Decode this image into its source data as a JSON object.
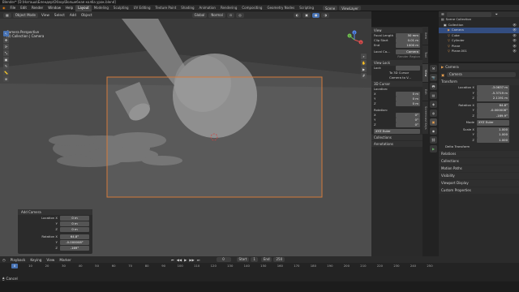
{
  "window": {
    "title": "Blender* [D:\\Наташа\\Блендер\\Обзор\\Волшебная колба урок.blend]"
  },
  "menu": {
    "items": [
      "File",
      "Edit",
      "Render",
      "Window",
      "Help"
    ],
    "workspaces": [
      "Layout",
      "Modeling",
      "Sculpting",
      "UV Editing",
      "Texture Paint",
      "Shading",
      "Animation",
      "Rendering",
      "Compositing",
      "Geometry Nodes",
      "Scripting"
    ],
    "active_workspace": "Layout",
    "scene_label": "Scene",
    "viewlayer_label": "ViewLayer"
  },
  "viewport_header": {
    "mode": "Object Mode",
    "view": "View",
    "select": "Select",
    "add": "Add",
    "object": "Object",
    "orientation": "Global",
    "pivot": "Normal"
  },
  "viewport": {
    "title_line1": "Camera Perspective",
    "title_line2": "(0) Collection | Camera",
    "gizmo_x": "X",
    "gizmo_y": "Y",
    "gizmo_z": "Z"
  },
  "toolbar": {
    "tools": [
      "↖",
      "✥",
      "⟳",
      "⤡",
      "▣",
      "✎",
      "📏",
      "⊞"
    ]
  },
  "npanel": {
    "view_header": "View",
    "focal_label": "Focal Length",
    "focal_value": "50 mm",
    "clip_start_label": "Clip Start",
    "clip_start_value": "0.01 m",
    "clip_end_label": "End",
    "clip_end_value": "1000 m",
    "local_camera_label": "Local Ca...",
    "local_camera_value": "Camera",
    "render_region": "Render Region",
    "view_lock_header": "View Lock",
    "lock_label": "Lock",
    "lock_value": "",
    "to_cursor": "To 3D Cursor",
    "camera_to_view": "Camera to V...",
    "cursor_header": "3D Cursor",
    "location_label": "Location:",
    "rotation_label": "Rotation:",
    "x": "X",
    "y": "Y",
    "z": "Z",
    "cursor_loc": [
      "0 m",
      "0 m",
      "0 m"
    ],
    "cursor_rot": [
      "0°",
      "0°",
      "0°"
    ],
    "euler": "XYZ Euler",
    "collections": "Collections",
    "annotations": "Annotations"
  },
  "sidetabs": [
    "Item",
    "Tool",
    "View",
    "Edit",
    "Screencast Keys"
  ],
  "outliner": {
    "search": "",
    "items": [
      {
        "name": "Scene Collection",
        "indent": 0,
        "selected": false
      },
      {
        "name": "Collection",
        "indent": 1,
        "selected": false
      },
      {
        "name": "Camera",
        "indent": 2,
        "selected": true
      },
      {
        "name": "Cube",
        "indent": 2,
        "selected": false
      },
      {
        "name": "Cylinder",
        "indent": 2,
        "selected": false
      },
      {
        "name": "Plane",
        "indent": 2,
        "selected": false
      },
      {
        "name": "Plane.001",
        "indent": 2,
        "selected": false
      }
    ]
  },
  "properties": {
    "breadcrumb": "Camera",
    "object_name": "Camera",
    "transform_header": "Transform",
    "location_label": "Location X",
    "y": "Y",
    "z": "Z",
    "location": [
      "-3.0637 m",
      "-5.3719 m",
      "2.1191 m"
    ],
    "rotation_label": "Rotation X",
    "rotation": [
      "64.8°",
      "-0.000008°",
      "-169.9°"
    ],
    "mode_label": "Mode",
    "mode_value": "XYZ Euler",
    "scale_label": "Scale X",
    "scale": [
      "1.000",
      "1.000",
      "1.000"
    ],
    "delta_transform": "Delta Transform",
    "sections": [
      "Relations",
      "Collections",
      "Motion Paths",
      "Visibility",
      "Viewport Display",
      "Custom Properties"
    ]
  },
  "operator_panel": {
    "title": "Add Camera",
    "location_label": "Location X",
    "rotation_label": "Rotation X",
    "y": "Y",
    "z": "Z",
    "location": [
      "0 m",
      "0 m",
      "0 m"
    ],
    "rotation": [
      "64.8°",
      "-0.000008°",
      "-169°"
    ]
  },
  "timeline": {
    "playback": "Playback",
    "keying": "Keying",
    "view": "View",
    "marker": "Marker",
    "current_frame": "0",
    "start_label": "Start",
    "start": "1",
    "end_label": "End",
    "end": "250",
    "ticks": [
      "0",
      "10",
      "20",
      "30",
      "40",
      "50",
      "60",
      "70",
      "80",
      "90",
      "100",
      "110",
      "120",
      "130",
      "140",
      "150",
      "160",
      "170",
      "180",
      "190",
      "200",
      "210",
      "220",
      "230",
      "240",
      "250"
    ]
  },
  "statusbar": {
    "text": "Cancel"
  }
}
